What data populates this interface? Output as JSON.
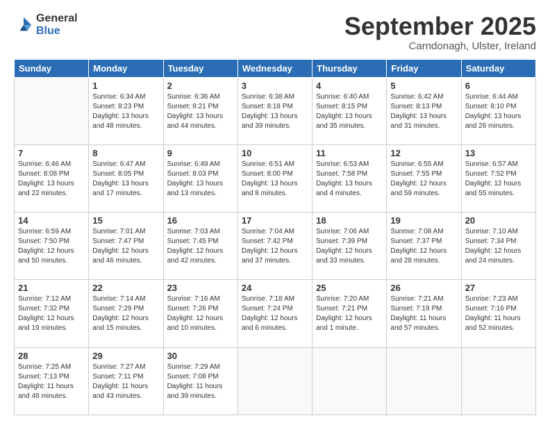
{
  "logo": {
    "general": "General",
    "blue": "Blue"
  },
  "header": {
    "month": "September 2025",
    "location": "Carndonagh, Ulster, Ireland"
  },
  "weekdays": [
    "Sunday",
    "Monday",
    "Tuesday",
    "Wednesday",
    "Thursday",
    "Friday",
    "Saturday"
  ],
  "weeks": [
    [
      {
        "day": "",
        "info": ""
      },
      {
        "day": "1",
        "info": "Sunrise: 6:34 AM\nSunset: 8:23 PM\nDaylight: 13 hours and 48 minutes."
      },
      {
        "day": "2",
        "info": "Sunrise: 6:36 AM\nSunset: 8:21 PM\nDaylight: 13 hours and 44 minutes."
      },
      {
        "day": "3",
        "info": "Sunrise: 6:38 AM\nSunset: 8:18 PM\nDaylight: 13 hours and 39 minutes."
      },
      {
        "day": "4",
        "info": "Sunrise: 6:40 AM\nSunset: 8:15 PM\nDaylight: 13 hours and 35 minutes."
      },
      {
        "day": "5",
        "info": "Sunrise: 6:42 AM\nSunset: 8:13 PM\nDaylight: 13 hours and 31 minutes."
      },
      {
        "day": "6",
        "info": "Sunrise: 6:44 AM\nSunset: 8:10 PM\nDaylight: 13 hours and 26 minutes."
      }
    ],
    [
      {
        "day": "7",
        "info": "Sunrise: 6:46 AM\nSunset: 8:08 PM\nDaylight: 13 hours and 22 minutes."
      },
      {
        "day": "8",
        "info": "Sunrise: 6:47 AM\nSunset: 8:05 PM\nDaylight: 13 hours and 17 minutes."
      },
      {
        "day": "9",
        "info": "Sunrise: 6:49 AM\nSunset: 8:03 PM\nDaylight: 13 hours and 13 minutes."
      },
      {
        "day": "10",
        "info": "Sunrise: 6:51 AM\nSunset: 8:00 PM\nDaylight: 13 hours and 8 minutes."
      },
      {
        "day": "11",
        "info": "Sunrise: 6:53 AM\nSunset: 7:58 PM\nDaylight: 13 hours and 4 minutes."
      },
      {
        "day": "12",
        "info": "Sunrise: 6:55 AM\nSunset: 7:55 PM\nDaylight: 12 hours and 59 minutes."
      },
      {
        "day": "13",
        "info": "Sunrise: 6:57 AM\nSunset: 7:52 PM\nDaylight: 12 hours and 55 minutes."
      }
    ],
    [
      {
        "day": "14",
        "info": "Sunrise: 6:59 AM\nSunset: 7:50 PM\nDaylight: 12 hours and 50 minutes."
      },
      {
        "day": "15",
        "info": "Sunrise: 7:01 AM\nSunset: 7:47 PM\nDaylight: 12 hours and 46 minutes."
      },
      {
        "day": "16",
        "info": "Sunrise: 7:03 AM\nSunset: 7:45 PM\nDaylight: 12 hours and 42 minutes."
      },
      {
        "day": "17",
        "info": "Sunrise: 7:04 AM\nSunset: 7:42 PM\nDaylight: 12 hours and 37 minutes."
      },
      {
        "day": "18",
        "info": "Sunrise: 7:06 AM\nSunset: 7:39 PM\nDaylight: 12 hours and 33 minutes."
      },
      {
        "day": "19",
        "info": "Sunrise: 7:08 AM\nSunset: 7:37 PM\nDaylight: 12 hours and 28 minutes."
      },
      {
        "day": "20",
        "info": "Sunrise: 7:10 AM\nSunset: 7:34 PM\nDaylight: 12 hours and 24 minutes."
      }
    ],
    [
      {
        "day": "21",
        "info": "Sunrise: 7:12 AM\nSunset: 7:32 PM\nDaylight: 12 hours and 19 minutes."
      },
      {
        "day": "22",
        "info": "Sunrise: 7:14 AM\nSunset: 7:29 PM\nDaylight: 12 hours and 15 minutes."
      },
      {
        "day": "23",
        "info": "Sunrise: 7:16 AM\nSunset: 7:26 PM\nDaylight: 12 hours and 10 minutes."
      },
      {
        "day": "24",
        "info": "Sunrise: 7:18 AM\nSunset: 7:24 PM\nDaylight: 12 hours and 6 minutes."
      },
      {
        "day": "25",
        "info": "Sunrise: 7:20 AM\nSunset: 7:21 PM\nDaylight: 12 hours and 1 minute."
      },
      {
        "day": "26",
        "info": "Sunrise: 7:21 AM\nSunset: 7:19 PM\nDaylight: 11 hours and 57 minutes."
      },
      {
        "day": "27",
        "info": "Sunrise: 7:23 AM\nSunset: 7:16 PM\nDaylight: 11 hours and 52 minutes."
      }
    ],
    [
      {
        "day": "28",
        "info": "Sunrise: 7:25 AM\nSunset: 7:13 PM\nDaylight: 11 hours and 48 minutes."
      },
      {
        "day": "29",
        "info": "Sunrise: 7:27 AM\nSunset: 7:11 PM\nDaylight: 11 hours and 43 minutes."
      },
      {
        "day": "30",
        "info": "Sunrise: 7:29 AM\nSunset: 7:08 PM\nDaylight: 11 hours and 39 minutes."
      },
      {
        "day": "",
        "info": ""
      },
      {
        "day": "",
        "info": ""
      },
      {
        "day": "",
        "info": ""
      },
      {
        "day": "",
        "info": ""
      }
    ]
  ]
}
